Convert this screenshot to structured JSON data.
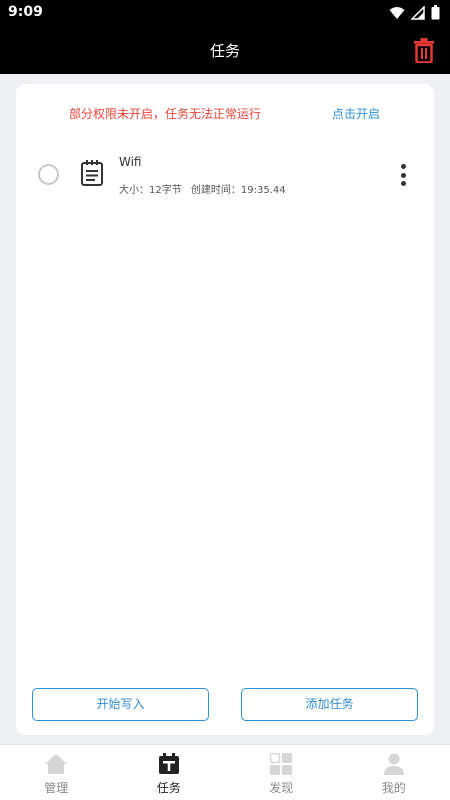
{
  "status_bar": {
    "time": "9:09"
  },
  "header": {
    "title": "任务"
  },
  "permission_banner": {
    "message": "部分权限未开启，任务无法正常运行",
    "action": "点击开启"
  },
  "tasks": [
    {
      "name": "Wifi",
      "size": "大小：12字节",
      "created": "创建时间：19:35.44"
    }
  ],
  "buttons": {
    "start_write": "开始写入",
    "add_task": "添加任务"
  },
  "bottom_nav": [
    {
      "label": "管理",
      "icon": "home-icon",
      "active": false
    },
    {
      "label": "任务",
      "icon": "task-icon",
      "active": true
    },
    {
      "label": "发现",
      "icon": "grid-icon",
      "active": false
    },
    {
      "label": "我的",
      "icon": "person-icon",
      "active": false
    }
  ],
  "colors": {
    "accent": "#2f8fd8",
    "warning": "#e5453a",
    "delete": "#e53935"
  }
}
